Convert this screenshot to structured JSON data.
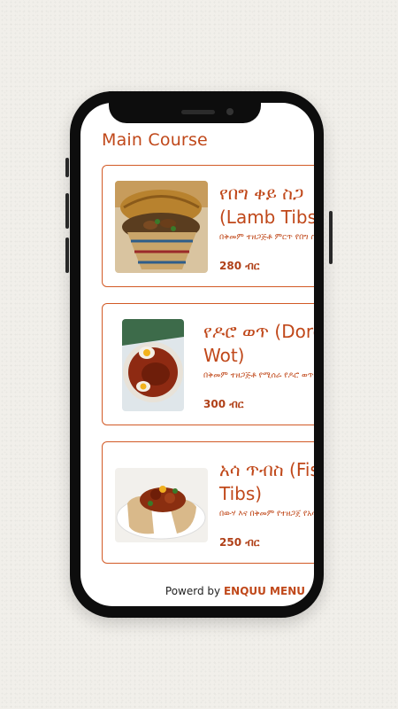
{
  "page": {
    "title": "Main Course"
  },
  "menu_items": [
    {
      "name": "የበግ ቀይ ስጋ (Lamb Tibs)",
      "description": "በቅመም ተዘጋጅቶ ምርጥ የበግ ስጋ።",
      "price": "280 ብር",
      "image": "lamb-tibs-photo"
    },
    {
      "name": "የዶሮ ወጥ (Doro Wot)",
      "description": "በቅመም ተዘጋጅቶ የሚሰራ የዶሮ ወጥ።",
      "price": "300 ብር",
      "image": "doro-wot-photo"
    },
    {
      "name": "አሳ ጥብስ (Fish Tibs)",
      "description": "በውሃ እና በቅመም የተዘጋጀ የአሳ ምግብ።",
      "price": "250 ብር",
      "image": "fish-tibs-photo"
    }
  ],
  "footer": {
    "prefix": "Powerd by",
    "brand": "ENQUU MENU"
  },
  "colors": {
    "accent": "#c0481a",
    "card_border": "#d25a26",
    "phone_frame": "#0d0d0d"
  }
}
